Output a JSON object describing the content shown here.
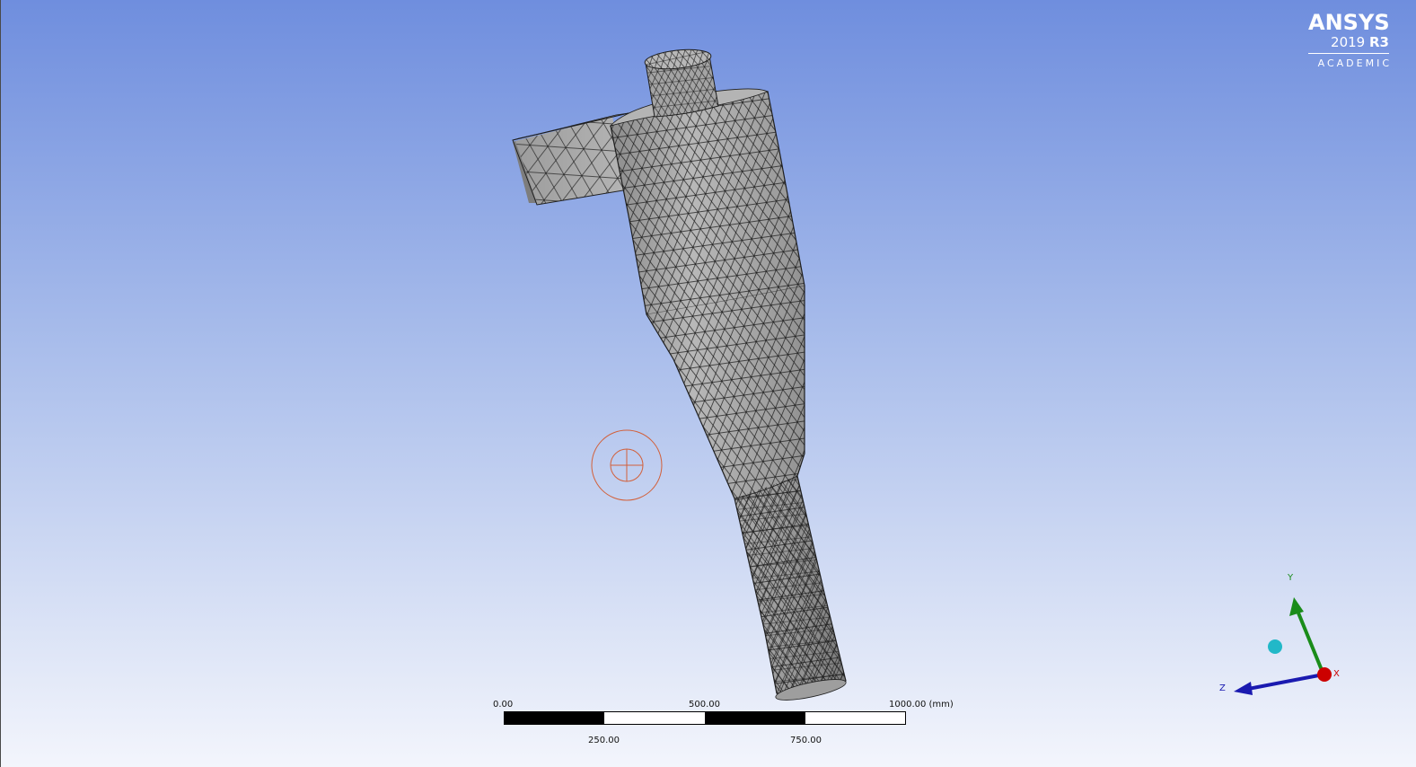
{
  "branding": {
    "product": "ANSYS",
    "version_year": "2019",
    "version_release": "R3",
    "edition": "ACADEMIC"
  },
  "scale_bar": {
    "top_labels": [
      "0.00",
      "500.00",
      "1000.00 (mm)"
    ],
    "bottom_labels": [
      "250.00",
      "750.00"
    ]
  },
  "triad": {
    "y_label": "Y",
    "x_label": "X",
    "z_label": "Z",
    "colors": {
      "x": "#cc0000",
      "y": "#1a8c1a",
      "z": "#1a1ab0",
      "iso_ball": "#22b8c8"
    }
  },
  "viewport": {
    "mesh_fill": "#a9a9a9",
    "mesh_line": "#1e1e1e",
    "rotation_center_color": "#d2603a",
    "background_top": "#6f8ede",
    "background_bottom": "#f3f5fc"
  }
}
